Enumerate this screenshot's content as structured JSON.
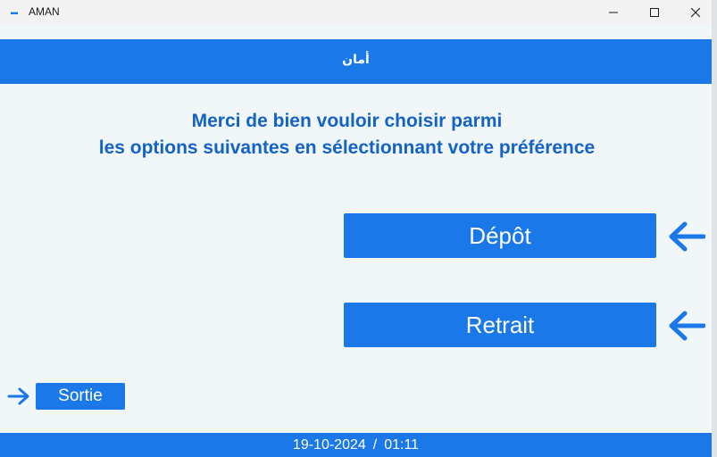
{
  "window": {
    "title": "AMAN",
    "app_icon": "aman-logo-icon",
    "controls": [
      "minimize-icon",
      "maximize-icon",
      "close-icon"
    ]
  },
  "header": {
    "logo_text": "أمان"
  },
  "instructions": {
    "line1": "Merci de bien vouloir choisir parmi",
    "line2": "les options suivantes en sélectionnant votre préférence"
  },
  "options": [
    {
      "label": "Dépôt",
      "icon": "arrow-left-icon"
    },
    {
      "label": "Retrait",
      "icon": "arrow-left-icon"
    }
  ],
  "exit": {
    "label": "Sortie",
    "icon": "arrow-right-icon"
  },
  "footer": {
    "date": "19-10-2024",
    "separator": "/",
    "time": "01:11"
  },
  "colors": {
    "primary": "#1a78e8",
    "heading": "#1263c5",
    "background": "#f1f6f8",
    "titlebar": "#f3f3f3"
  }
}
